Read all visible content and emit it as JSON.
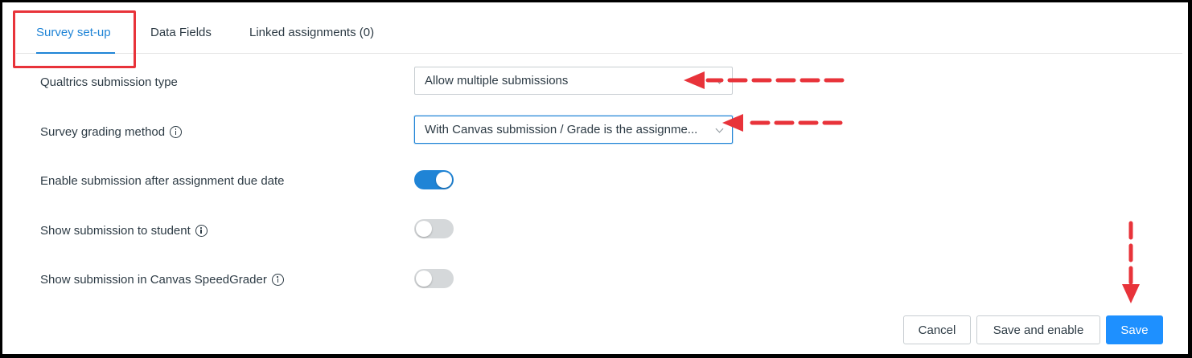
{
  "tabs": [
    {
      "label": "Survey set-up",
      "active": true
    },
    {
      "label": "Data Fields",
      "active": false
    },
    {
      "label": "Linked assignments (0)",
      "active": false
    }
  ],
  "form": {
    "submission_type": {
      "label": "Qualtrics submission type",
      "value": "Allow multiple submissions"
    },
    "grading_method": {
      "label": "Survey grading method",
      "value": "With Canvas submission / Grade is the assignme..."
    },
    "enable_after_due": {
      "label": "Enable submission after assignment due date",
      "on": true
    },
    "show_to_student": {
      "label": "Show submission to student",
      "on": false
    },
    "show_in_speedgrader": {
      "label": "Show submission in Canvas SpeedGrader",
      "on": false
    }
  },
  "buttons": {
    "cancel": "Cancel",
    "save_enable": "Save and enable",
    "save": "Save"
  },
  "colors": {
    "accent": "#1f84d6",
    "primary_button": "#1e90ff",
    "annotation_red": "#e8333a"
  },
  "icons": [
    "info-icon",
    "chevron-down-icon"
  ]
}
